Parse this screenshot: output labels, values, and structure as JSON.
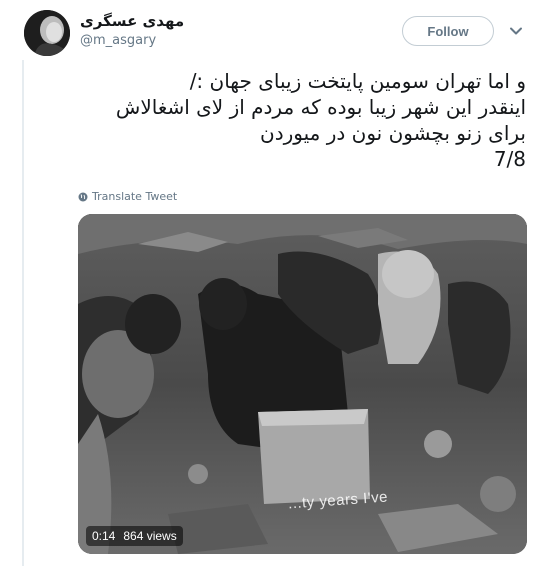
{
  "tweet": {
    "author": {
      "display_name": "مهدی عسگری",
      "handle": "@m_asgary"
    },
    "follow_label": "Follow",
    "text_lines": [
      "و اما تهران سومین پایتخت زیبای جهان :/",
      "اینقدر این شهر زیبا بوده که مردم از لای اشغالاش",
      "برای زنو بچشون نون در میوردن",
      "7/8"
    ],
    "translate_label": "Translate Tweet",
    "video": {
      "time": "0:14",
      "views": "864 views",
      "subtitle": "...ty years I've"
    }
  },
  "icons": {
    "chevron": "chevron-down-icon",
    "globe": "globe-icon"
  },
  "colors": {
    "text": "#14171a",
    "secondary": "#657786",
    "border": "#e6ecf0"
  }
}
